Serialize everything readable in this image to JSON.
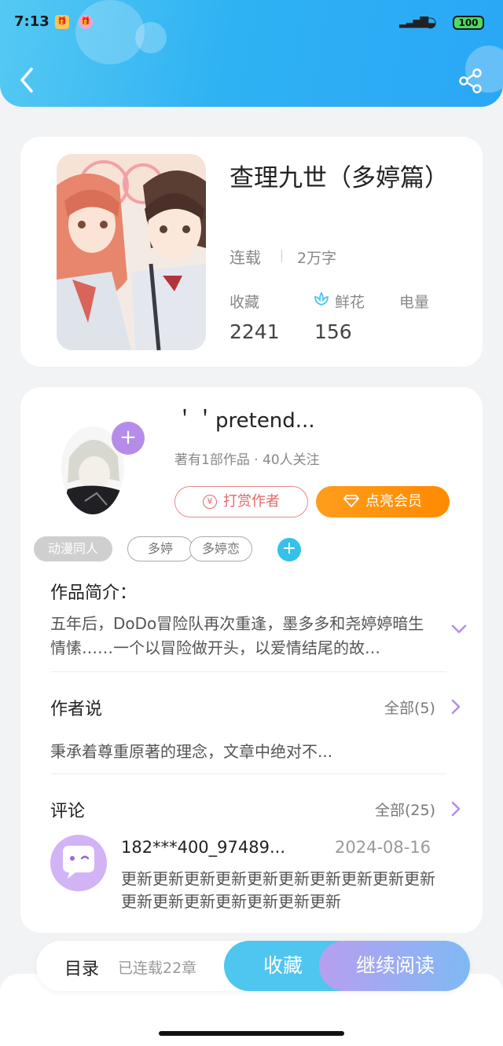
{
  "status_bar": {
    "time": "7:13",
    "battery": "100",
    "app_badge_1": "🎁",
    "app_badge_2": "🎁"
  },
  "header": {
    "back_icon": "back-arrow-icon",
    "share_icon": "share-icon"
  },
  "book": {
    "title": "查理九世（多婷篇）",
    "status": "连载",
    "word_count": "2万字",
    "stats": [
      {
        "label": "收藏",
        "value": "2241"
      },
      {
        "label": "鲜花",
        "value": "156"
      },
      {
        "label": "电量",
        "value": ""
      }
    ]
  },
  "author": {
    "name": "＇＇pretend...",
    "meta": "著有1部作品 · 40人关注",
    "follow_label": "+",
    "reward_label": "打赏作者",
    "reward_icon_char": "¥",
    "vip_label": "点亮会员"
  },
  "tags": {
    "items": [
      "动漫同人",
      "多婷",
      "多婷恋"
    ],
    "add_label": "+"
  },
  "intro": {
    "title": "作品简介：",
    "text": "五年后，DoDo冒险队再次重逢，墨多多和尧婷婷暗生情愫……一个以冒险做开头，以爱情结尾的故…"
  },
  "author_says": {
    "title": "作者说",
    "all_label": "全部(5)",
    "text": "秉承着尊重原著的理念，文章中绝对不..."
  },
  "comments": {
    "title": "评论",
    "all_label": "全部(25)",
    "items": [
      {
        "user": "182***400_97489...",
        "date": "2024-08-16",
        "text": "更新更新更新更新更新更新更新更新更新更新更新更新更新更新更新更新更新"
      }
    ]
  },
  "bottom_bar": {
    "toc_label": "目录",
    "toc_count": "已连载22章",
    "favorite_label": "收藏",
    "read_label": "继续阅读"
  },
  "colors": {
    "header_blue": "#2fb2f3",
    "accent_purple": "#b58de8",
    "vip_orange": "#ff8a00",
    "reward_red": "#e06a6a",
    "tag_blue": "#35c1ea"
  }
}
